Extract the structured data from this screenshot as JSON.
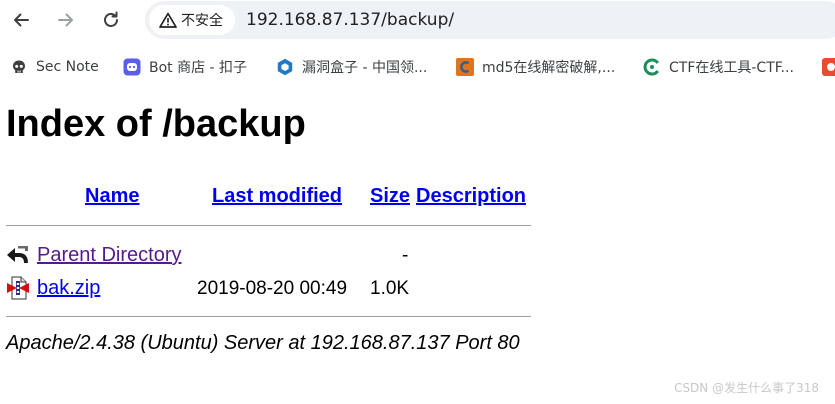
{
  "toolbar": {
    "security_label": "不安全",
    "url": "192.168.87.137/backup/"
  },
  "bookmarks": [
    {
      "label": "Sec Note",
      "icon": "skull-icon"
    },
    {
      "label": "Bot 商店 - 扣子",
      "icon": "bot-store-icon"
    },
    {
      "label": "漏洞盒子 - 中国领...",
      "icon": "vulbox-icon"
    },
    {
      "label": "md5在线解密破解,...",
      "icon": "cmd5-icon"
    },
    {
      "label": "CTF在线工具-CTF...",
      "icon": "ctf-tools-icon"
    }
  ],
  "page": {
    "title": "Index of /backup",
    "columns": {
      "name": "Name",
      "last_modified": "Last modified",
      "size": "Size",
      "description": "Description"
    },
    "rows": [
      {
        "name": "Parent Directory",
        "last_modified": "",
        "size": "-",
        "description": "",
        "icon": "back-arrow-icon",
        "visited": true
      },
      {
        "name": "bak.zip",
        "last_modified": "2019-08-20 00:49",
        "size": "1.0K",
        "description": "",
        "icon": "compressed-file-icon",
        "visited": false
      }
    ],
    "address": "Apache/2.4.38 (Ubuntu) Server at 192.168.87.137 Port 80"
  },
  "watermark": "CSDN @发生什么事了318",
  "colors": {
    "link": "#0000ee",
    "visited_link": "#551a8b",
    "omnibox_bg": "#eef1f6"
  }
}
